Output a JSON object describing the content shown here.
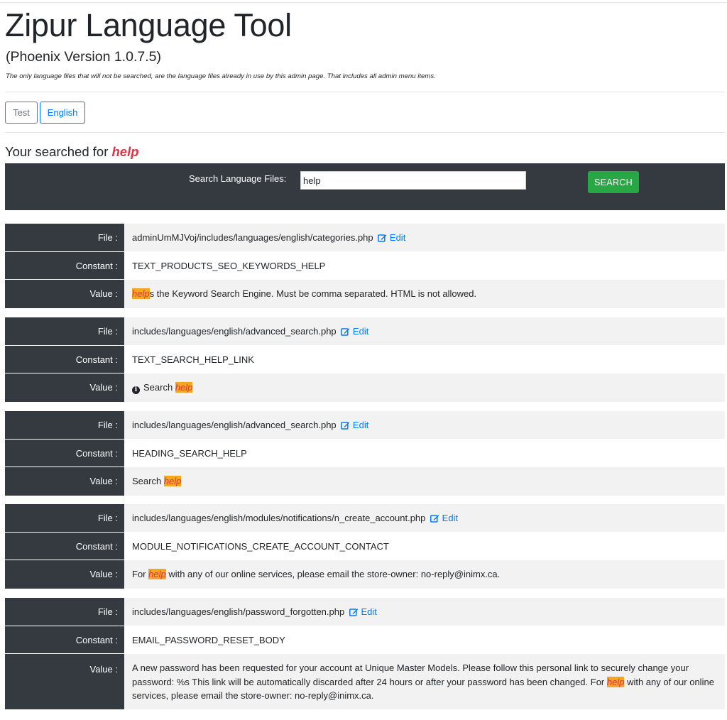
{
  "header": {
    "title": "Zipur Language Tool",
    "subtitle": "(Phoenix Version 1.0.7.5)",
    "note": "The only language files that will not be searched, are the language files already in use by this admin page. That includes all admin menu items."
  },
  "languages": [
    "Test",
    "English"
  ],
  "searched": {
    "prefix": "Your searched for",
    "term": "help"
  },
  "search": {
    "label": "Search Language Files:",
    "value": "help",
    "button": "SEARCH"
  },
  "labels": {
    "file": "File :",
    "constant": "Constant :",
    "value": "Value :",
    "edit": "Edit"
  },
  "colors": {
    "dark": "#343a40",
    "link": "#007bff",
    "success": "#28a745",
    "highlight_bg": "#f5a623",
    "highlight_fg": "#dc3545"
  },
  "results": [
    {
      "file": "adminUmMJVoj/includes/languages/english/categories.php",
      "constant": "TEXT_PRODUCTS_SEO_KEYWORDS_HELP",
      "value": {
        "before": "",
        "match": "help",
        "after": "s the Keyword Search Engine. Must be comma separated. HTML is not allowed."
      }
    },
    {
      "file": "includes/languages/english/advanced_search.php",
      "constant": "TEXT_SEARCH_HELP_LINK",
      "value": {
        "icon": "info-circle-icon",
        "before": "Search ",
        "match": "help",
        "after": ""
      }
    },
    {
      "file": "includes/languages/english/advanced_search.php",
      "constant": "HEADING_SEARCH_HELP",
      "value": {
        "before": "Search ",
        "match": "help",
        "after": ""
      }
    },
    {
      "file": "includes/languages/english/modules/notifications/n_create_account.php",
      "constant": "MODULE_NOTIFICATIONS_CREATE_ACCOUNT_CONTACT",
      "value": {
        "before": "For ",
        "match": "help",
        "after": " with any of our online services, please email the store-owner: no-reply@inimx.ca."
      }
    },
    {
      "file": "includes/languages/english/password_forgotten.php",
      "constant": "EMAIL_PASSWORD_RESET_BODY",
      "value": {
        "before": "A new password has been requested for your account at Unique Master Models. Please follow this personal link to securely change your password: %s This link will be automatically discarded after 24 hours or after your password has been changed. For ",
        "match": "help",
        "after": " with any of our online services, please email the store-owner: no-reply@inimx.ca."
      }
    }
  ]
}
